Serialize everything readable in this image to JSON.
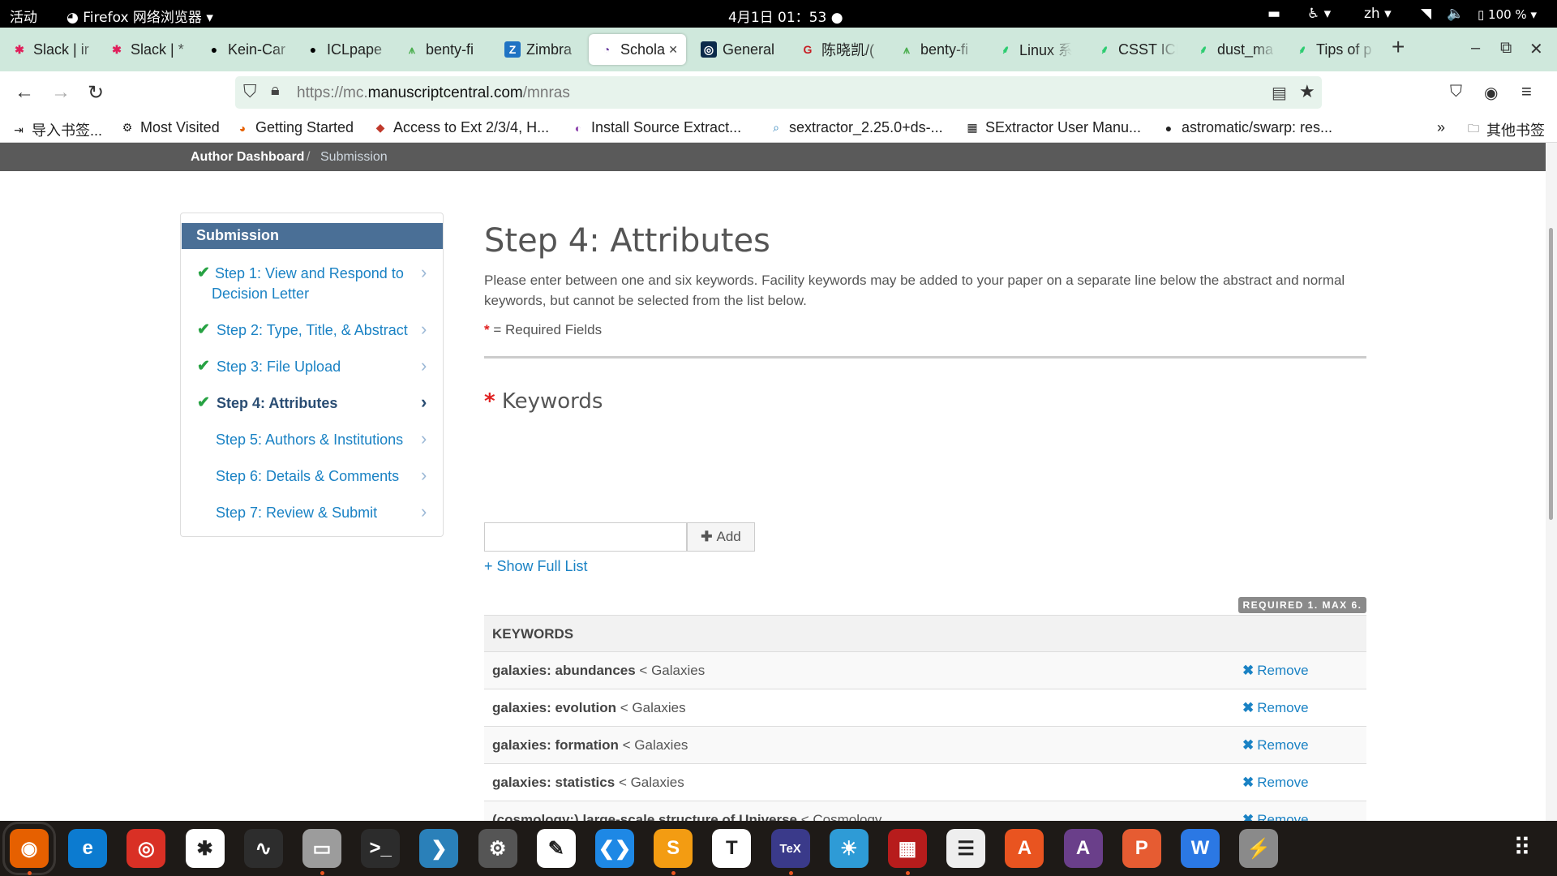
{
  "topbar": {
    "activities": "活动",
    "app_name": "Firefox 网络浏览器",
    "clock": "4月1日  01：53",
    "lang": "zh",
    "battery": "100 %"
  },
  "tabs": [
    {
      "label": "Slack | ir",
      "icon": "slack-icon",
      "color": "#e01e5a"
    },
    {
      "label": "Slack | *",
      "icon": "slack-icon",
      "color": "#e01e5a"
    },
    {
      "label": "Kein-Car",
      "icon": "github-icon",
      "color": "#000000"
    },
    {
      "label": "ICLpape",
      "icon": "github-icon",
      "color": "#000000"
    },
    {
      "label": "benty-fi",
      "icon": "grass-icon",
      "color": "#4caf50"
    },
    {
      "label": "Zimbra",
      "icon": "zimbra-icon",
      "color": "#1f73c3"
    },
    {
      "label": "Schola",
      "icon": "scholarone-icon",
      "color": "#6b3fa0"
    },
    {
      "label": "General",
      "icon": "general-icon",
      "color": "#0b2a4a"
    },
    {
      "label": "陈晓凯/(",
      "icon": "gitee-icon",
      "color": "#c71d23"
    },
    {
      "label": "benty-fi",
      "icon": "grass-icon",
      "color": "#4caf50"
    },
    {
      "label": "Linux 系",
      "icon": "feather-icon",
      "color": "#2ecc71"
    },
    {
      "label": "CSST ICL",
      "icon": "feather-icon",
      "color": "#2ecc71"
    },
    {
      "label": "dust_ma",
      "icon": "feather-icon",
      "color": "#2ecc71"
    },
    {
      "label": "Tips of p",
      "icon": "feather-icon",
      "color": "#2ecc71"
    }
  ],
  "nav": {
    "url_prefix": "https://mc.",
    "url_domain": "manuscriptcentral.com",
    "url_path": "/mnras"
  },
  "bookmarks": [
    {
      "label": "导入书签...",
      "icon": "import-icon"
    },
    {
      "label": "Most Visited",
      "icon": "gear-icon"
    },
    {
      "label": "Getting Started",
      "icon": "firefox-icon"
    },
    {
      "label": "Access to Ext 2/3/4, H...",
      "icon": "ext-icon"
    },
    {
      "label": "Install Source Extract...",
      "icon": "source-icon"
    },
    {
      "label": "sextractor_2.25.0+ds-...",
      "icon": "search-icon"
    },
    {
      "label": "SExtractor User Manu...",
      "icon": "doc-icon"
    },
    {
      "label": "astromatic/swarp: res...",
      "icon": "github-icon"
    }
  ],
  "bookmarks_other": "其他书签",
  "breadcrumb": {
    "dashboard": "Author Dashboard",
    "separator": "/",
    "current": "Submission"
  },
  "sidebar": {
    "title": "Submission",
    "steps": [
      {
        "label": "Step 1: View and Respond to Decision Letter",
        "done": true
      },
      {
        "label": "Step 2: Type, Title, & Abstract",
        "done": true
      },
      {
        "label": "Step 3: File Upload",
        "done": true
      },
      {
        "label": "Step 4: Attributes",
        "done": true,
        "current": true
      },
      {
        "label": "Step 5: Authors & Institutions",
        "done": false
      },
      {
        "label": "Step 6: Details & Comments",
        "done": false
      },
      {
        "label": "Step 7: Review & Submit",
        "done": false
      }
    ]
  },
  "main": {
    "title": "Step 4: Attributes",
    "intro": "Please enter between one and six keywords. Facility keywords may be added to your paper on a separate line below the abstract and normal keywords, but cannot be selected from the list below.",
    "required_star": "*",
    "required_note": "= Required Fields",
    "keywords_label": "Keywords",
    "keyword_input_value": "",
    "add_label": "Add",
    "show_full_list": "+ Show Full List",
    "badge": "REQUIRED 1. MAX 6.",
    "table_header": "KEYWORDS",
    "remove_label": "Remove",
    "keywords": [
      {
        "keyword": "galaxies: abundances",
        "category": "< Galaxies"
      },
      {
        "keyword": "galaxies: evolution",
        "category": "< Galaxies"
      },
      {
        "keyword": "galaxies: formation",
        "category": "< Galaxies"
      },
      {
        "keyword": "galaxies: statistics",
        "category": "< Galaxies"
      },
      {
        "keyword": "(cosmology:) large-scale structure of Universe",
        "category": "< Cosmology"
      }
    ]
  },
  "dock": [
    {
      "icon": "firefox-icon",
      "color": "#e66000",
      "glyph": "◉",
      "running": true
    },
    {
      "icon": "edge-icon",
      "color": "#0c7bd0",
      "glyph": "e",
      "running": false
    },
    {
      "icon": "chrome-icon",
      "color": "#d93025",
      "glyph": "◎",
      "running": false
    },
    {
      "icon": "slack-icon",
      "color": "#ffffff",
      "glyph": "✱",
      "running": false
    },
    {
      "icon": "system-monitor-icon",
      "color": "#2d2d2d",
      "glyph": "∿",
      "running": false
    },
    {
      "icon": "files-icon",
      "color": "#9c9c9c",
      "glyph": "▭",
      "running": true
    },
    {
      "icon": "terminal-icon",
      "color": "#2c2c2c",
      "glyph": ">_",
      "running": false
    },
    {
      "icon": "remmina-icon",
      "color": "#2a80b9",
      "glyph": "❯",
      "running": false
    },
    {
      "icon": "settings-icon",
      "color": "#555555",
      "glyph": "⚙",
      "running": false
    },
    {
      "icon": "text-editor-icon",
      "color": "#ffffff",
      "glyph": "✎",
      "running": false
    },
    {
      "icon": "vscode-icon",
      "color": "#1e88e5",
      "glyph": "❮❯",
      "running": false
    },
    {
      "icon": "sublime-icon",
      "color": "#f39c12",
      "glyph": "S",
      "running": true
    },
    {
      "icon": "typora-icon",
      "color": "#ffffff",
      "glyph": "T",
      "running": false
    },
    {
      "icon": "texstudio-icon",
      "color": "#3a3a8a",
      "glyph": "TeX",
      "running": true
    },
    {
      "icon": "astronomy-icon",
      "color": "#2e9bd6",
      "glyph": "☀",
      "running": false
    },
    {
      "icon": "ds9-icon",
      "color": "#b71c1c",
      "glyph": "▦",
      "running": true
    },
    {
      "icon": "document-viewer-icon",
      "color": "#eeeeee",
      "glyph": "☰",
      "running": false
    },
    {
      "icon": "software-center-icon",
      "color": "#e95420",
      "glyph": "A",
      "running": false
    },
    {
      "icon": "app-icon",
      "color": "#6a3f8a",
      "glyph": "A",
      "running": false
    },
    {
      "icon": "wps-presentation-icon",
      "color": "#e65c32",
      "glyph": "P",
      "running": false
    },
    {
      "icon": "wps-writer-icon",
      "color": "#2b78e4",
      "glyph": "W",
      "running": false
    },
    {
      "icon": "usb-icon",
      "color": "#8a8a8a",
      "glyph": "⚡",
      "running": false
    }
  ]
}
